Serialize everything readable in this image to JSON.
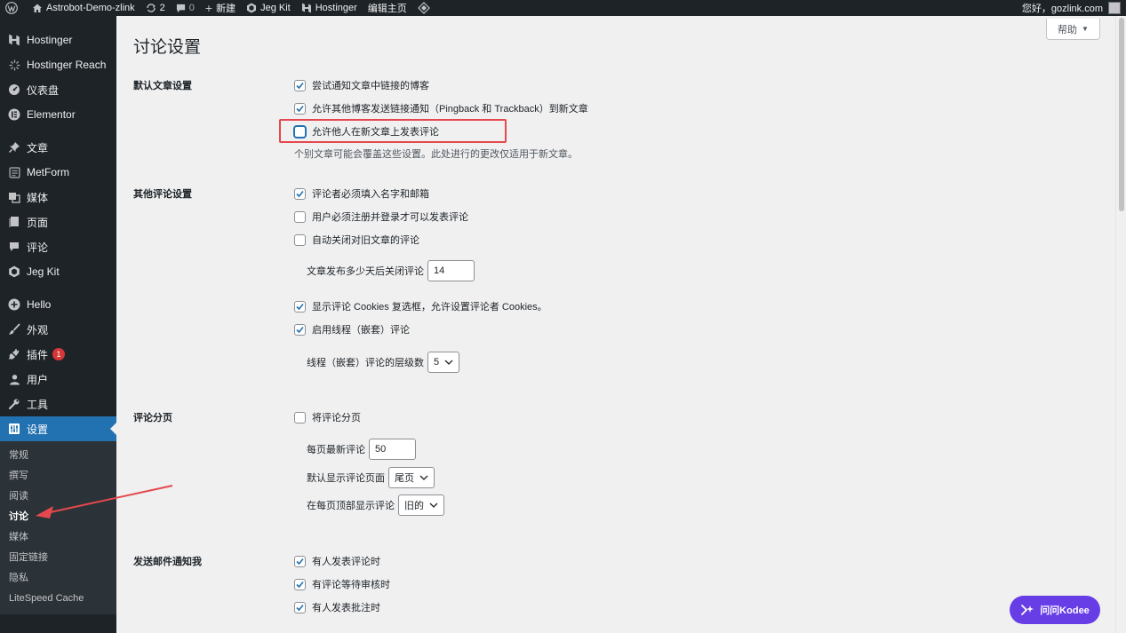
{
  "admin_bar": {
    "site_name": "Astrobot-Demo-zlink",
    "updates_count": "2",
    "comments_count": "0",
    "new_label": "新建",
    "jegkit_label": "Jeg Kit",
    "hostinger_label": "Hostinger",
    "edit_home_label": "编辑主页",
    "greeting": "您好，gozlink.com"
  },
  "sidebar": {
    "items": [
      {
        "label": "Hostinger",
        "icon": "hostinger-icon"
      },
      {
        "label": "Hostinger Reach",
        "icon": "reach-icon"
      },
      {
        "label": "仪表盘",
        "icon": "dashboard-icon"
      },
      {
        "label": "Elementor",
        "icon": "elementor-icon"
      },
      {
        "label": "文章",
        "icon": "pin-icon"
      },
      {
        "label": "MetForm",
        "icon": "metform-icon"
      },
      {
        "label": "媒体",
        "icon": "media-icon"
      },
      {
        "label": "页面",
        "icon": "page-icon"
      },
      {
        "label": "评论",
        "icon": "comment-icon"
      },
      {
        "label": "Jeg Kit",
        "icon": "jegkit-icon"
      },
      {
        "label": "Hello",
        "icon": "plus-circle-icon"
      },
      {
        "label": "外观",
        "icon": "brush-icon"
      },
      {
        "label": "插件",
        "icon": "plugin-icon",
        "badge": "1"
      },
      {
        "label": "用户",
        "icon": "user-icon"
      },
      {
        "label": "工具",
        "icon": "wrench-icon"
      },
      {
        "label": "设置",
        "icon": "settings-icon"
      }
    ],
    "submenu": [
      "常规",
      "撰写",
      "阅读",
      "讨论",
      "媒体",
      "固定链接",
      "隐私",
      "LiteSpeed Cache"
    ]
  },
  "page": {
    "title": "讨论设置",
    "help_label": "帮助"
  },
  "sections": {
    "default_post": {
      "label": "默认文章设置",
      "opt1": "尝试通知文章中链接的博客",
      "opt2": "允许其他博客发送链接通知（Pingback 和 Trackback）到新文章",
      "opt3": "允许他人在新文章上发表评论",
      "desc": "个别文章可能会覆盖这些设置。此处进行的更改仅适用于新文章。"
    },
    "other_comment": {
      "label": "其他评论设置",
      "opt1": "评论者必须填入名字和邮箱",
      "opt2": "用户必须注册并登录才可以发表评论",
      "opt3": "自动关闭对旧文章的评论",
      "close_days_label": "文章发布多少天后关闭评论",
      "close_days_value": "14",
      "opt4": "显示评论 Cookies 复选框，允许设置评论者 Cookies。",
      "opt5": "启用线程（嵌套）评论",
      "thread_depth_label": "线程（嵌套）评论的层级数",
      "thread_depth_value": "5"
    },
    "pagination": {
      "label": "评论分页",
      "opt1": "将评论分页",
      "per_page_label": "每页最新评论",
      "per_page_value": "50",
      "default_page_label": "默认显示评论页面",
      "default_page_value": "尾页",
      "order_label": "在每页顶部显示评论",
      "order_value": "旧的"
    },
    "email_notify": {
      "label": "发送邮件通知我",
      "opt1": "有人发表评论时",
      "opt2": "有评论等待审核时",
      "opt3": "有人发表批注时"
    }
  },
  "kodee": {
    "label": "问问Kodee"
  },
  "colors": {
    "accent": "#2271b1",
    "highlight": "#e5484d",
    "kodee": "#673de6"
  }
}
